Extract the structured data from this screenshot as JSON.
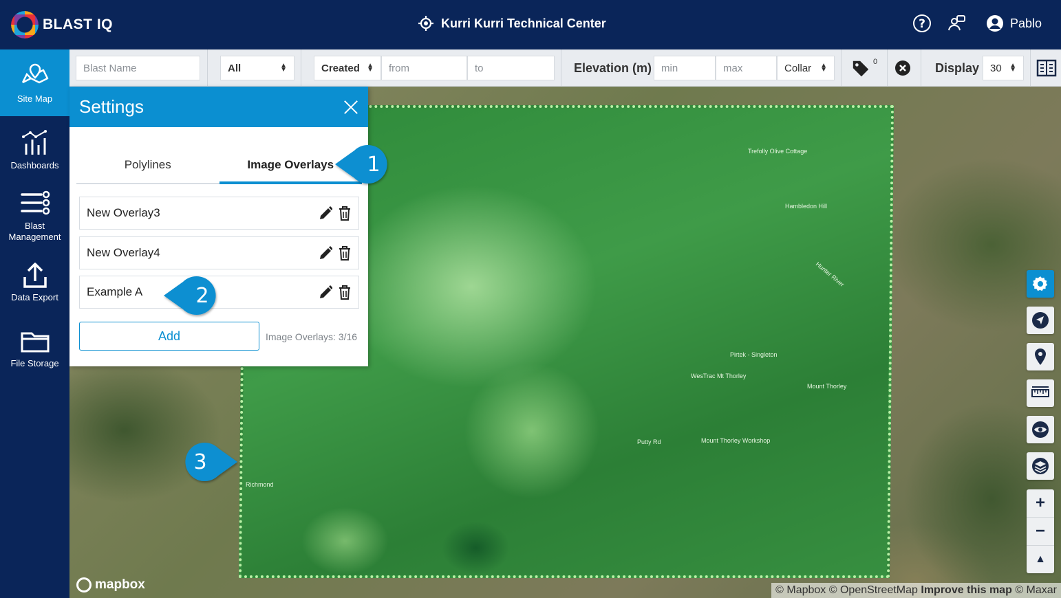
{
  "app": {
    "logo_text": "BLAST IQ",
    "site_title": "Kurri Kurri Technical Center",
    "user_name": "Pablo"
  },
  "sidebar": {
    "items": [
      {
        "label": "Site Map",
        "icon": "map-icon",
        "active": true
      },
      {
        "label": "Dashboards",
        "icon": "dashboard-icon",
        "active": false
      },
      {
        "label": "Blast Management",
        "icon": "blast-management-icon",
        "active": false
      },
      {
        "label": "Data Export",
        "icon": "upload-icon",
        "active": false
      },
      {
        "label": "File Storage",
        "icon": "folder-icon",
        "active": false
      }
    ]
  },
  "filters": {
    "blast_name_placeholder": "Blast Name",
    "type_select": "All",
    "date_field_select": "Created",
    "from_placeholder": "from",
    "to_placeholder": "to",
    "elevation_label": "Elevation (m)",
    "elevation_min_placeholder": "min",
    "elevation_max_placeholder": "max",
    "elevation_ref_select": "Collar",
    "tag_count": "0",
    "display_label": "Display",
    "display_select": "30"
  },
  "settings": {
    "title": "Settings",
    "tabs": [
      {
        "label": "Polylines",
        "active": false
      },
      {
        "label": "Image Overlays",
        "active": true
      }
    ],
    "overlays": [
      {
        "name": "New Overlay3"
      },
      {
        "name": "New Overlay4"
      },
      {
        "name": "Example A"
      }
    ],
    "add_label": "Add",
    "count_label": "Image Overlays: 3/16"
  },
  "callouts": [
    "1",
    "2",
    "3"
  ],
  "map": {
    "labels": [
      "Trefolly Olive Cottage",
      "Hambledon Hill",
      "Pirtek - Singleton",
      "WesTrac Mt Thorley",
      "Mount Thorley",
      "Mount Thorley Workshop",
      "Richmond",
      "Putty Rd",
      "Hunter River"
    ],
    "mapbox_logo": "mapbox",
    "attribution": {
      "mapbox": "© Mapbox",
      "osm": "© OpenStreetMap",
      "improve": "Improve this map",
      "maxar": "© Maxar"
    }
  },
  "map_controls": [
    "gear-icon",
    "navigate-icon",
    "location-pin-icon",
    "ruler-icon",
    "eye-icon",
    "layers-icon"
  ],
  "zoom": {
    "in": "+",
    "out": "−",
    "north": "▲"
  },
  "colors": {
    "navy": "#0a2559",
    "accent": "#0b8fd1"
  }
}
